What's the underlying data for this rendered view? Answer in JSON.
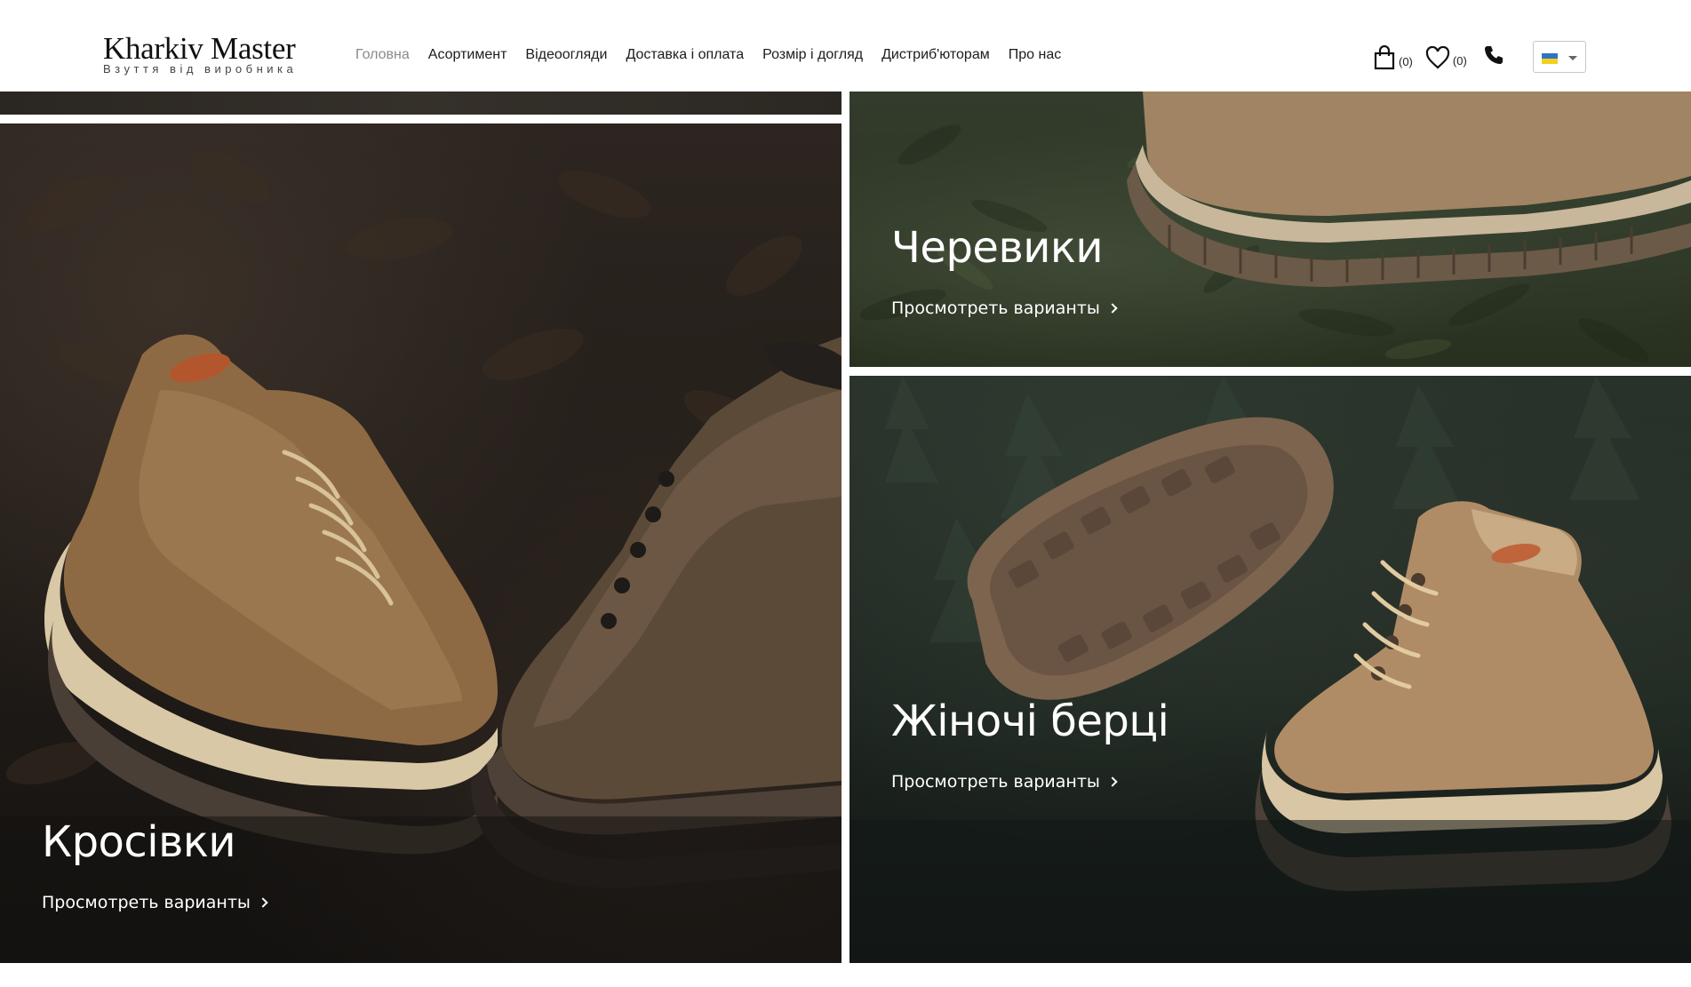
{
  "header": {
    "logo_title": "Kharkiv Master",
    "logo_subtitle": "Взуття від виробника",
    "nav": [
      {
        "label": "Головна",
        "active": true
      },
      {
        "label": "Асортимент",
        "active": false
      },
      {
        "label": "Відеоогляди",
        "active": false
      },
      {
        "label": "Доставка і оплата",
        "active": false
      },
      {
        "label": "Розмір і догляд",
        "active": false
      },
      {
        "label": "Дистриб'юторам",
        "active": false
      },
      {
        "label": "Про нас",
        "active": false
      }
    ],
    "cart_count": "(0)",
    "wishlist_count": "(0)",
    "icons": [
      "cart-icon",
      "heart-icon",
      "phone-icon"
    ],
    "language_flag": "ukraine-flag"
  },
  "tiles": {
    "boots": {
      "title": "Черевики",
      "link": "Просмотреть варианты"
    },
    "sneakers": {
      "title": "Кросівки",
      "link": "Просмотреть варианты"
    },
    "women": {
      "title": "Жіночі берці",
      "link": "Просмотреть варианты"
    }
  },
  "colors": {
    "flag_blue": "#2f73c6",
    "flag_yellow": "#f4cf1f",
    "nav_active": "#8a8a8a"
  }
}
